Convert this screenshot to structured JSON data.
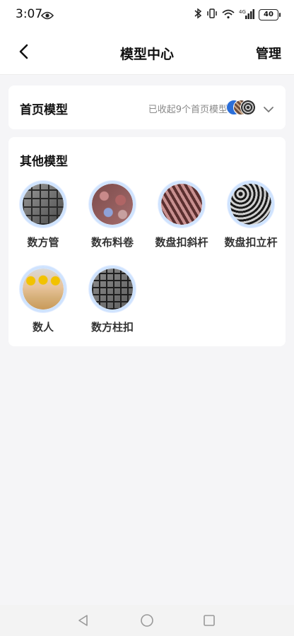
{
  "status": {
    "time": "3:07",
    "network": "4G",
    "battery": "40"
  },
  "nav": {
    "title": "模型中心",
    "manage": "管理"
  },
  "home_models": {
    "label": "首页模型",
    "collapsed_text": "已收起9个首页模型"
  },
  "other_models": {
    "label": "其他模型",
    "items": [
      {
        "name": "数方管",
        "image": "tube"
      },
      {
        "name": "数布料卷",
        "image": "roll"
      },
      {
        "name": "数盘扣斜杆",
        "image": "pan"
      },
      {
        "name": "数盘扣立杆",
        "image": "pole"
      },
      {
        "name": "数人",
        "image": "people"
      },
      {
        "name": "数方柱扣",
        "image": "square"
      }
    ]
  },
  "icons": {
    "eye": "eye-icon",
    "back": "back-arrow-icon",
    "chevron": "chevron-down-icon",
    "sys_back": "triangle-back-icon",
    "sys_home": "circle-home-icon",
    "sys_recent": "square-recent-icon"
  }
}
